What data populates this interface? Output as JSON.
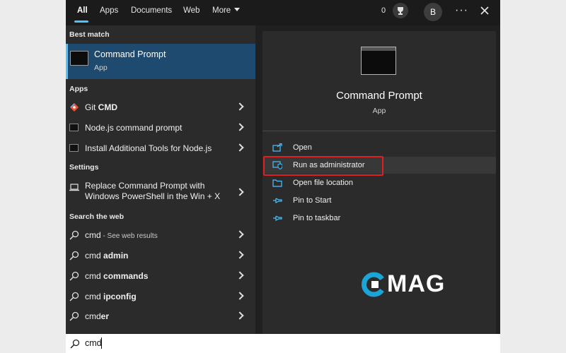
{
  "tabs": [
    {
      "label": "All"
    },
    {
      "label": "Apps"
    },
    {
      "label": "Documents"
    },
    {
      "label": "Web"
    },
    {
      "label": "More"
    }
  ],
  "header": {
    "points": "0",
    "avatar": "B",
    "more": "···"
  },
  "best_match": {
    "heading": "Best match",
    "title": "Command Prompt",
    "subtitle": "App"
  },
  "apps": {
    "heading": "Apps",
    "items": [
      {
        "label_plain": "Git ",
        "label_bold": "CMD"
      },
      {
        "label_plain": "Node.js command prompt",
        "label_bold": ""
      },
      {
        "label_plain": "Install Additional Tools for Node.js",
        "label_bold": ""
      }
    ]
  },
  "settings": {
    "heading": "Settings",
    "item_line1": "Replace Command Prompt with",
    "item_line2": "Windows PowerShell in the Win + X"
  },
  "web": {
    "heading": "Search the web",
    "items": [
      {
        "label_plain": "cmd",
        "label_bold": "",
        "suffix": " - See web results"
      },
      {
        "label_plain": "cmd ",
        "label_bold": "admin",
        "suffix": ""
      },
      {
        "label_plain": "cmd ",
        "label_bold": "commands",
        "suffix": ""
      },
      {
        "label_plain": "cmd ",
        "label_bold": "ipconfig",
        "suffix": ""
      },
      {
        "label_plain": "cmd",
        "label_bold": "er",
        "suffix": ""
      }
    ]
  },
  "detail": {
    "title": "Command Prompt",
    "subtitle": "App",
    "actions": [
      {
        "label": "Open",
        "icon": "open-icon"
      },
      {
        "label": "Run as administrator",
        "icon": "shield-icon"
      },
      {
        "label": "Open file location",
        "icon": "folder-icon"
      },
      {
        "label": "Pin to Start",
        "icon": "pin-icon"
      },
      {
        "label": "Pin to taskbar",
        "icon": "pin-icon"
      }
    ]
  },
  "watermark": "MAG",
  "search": {
    "value": "cmd"
  },
  "colors": {
    "accent": "#4cc2ff",
    "selection": "#1d4a6e",
    "highlight_box": "#e02020"
  }
}
